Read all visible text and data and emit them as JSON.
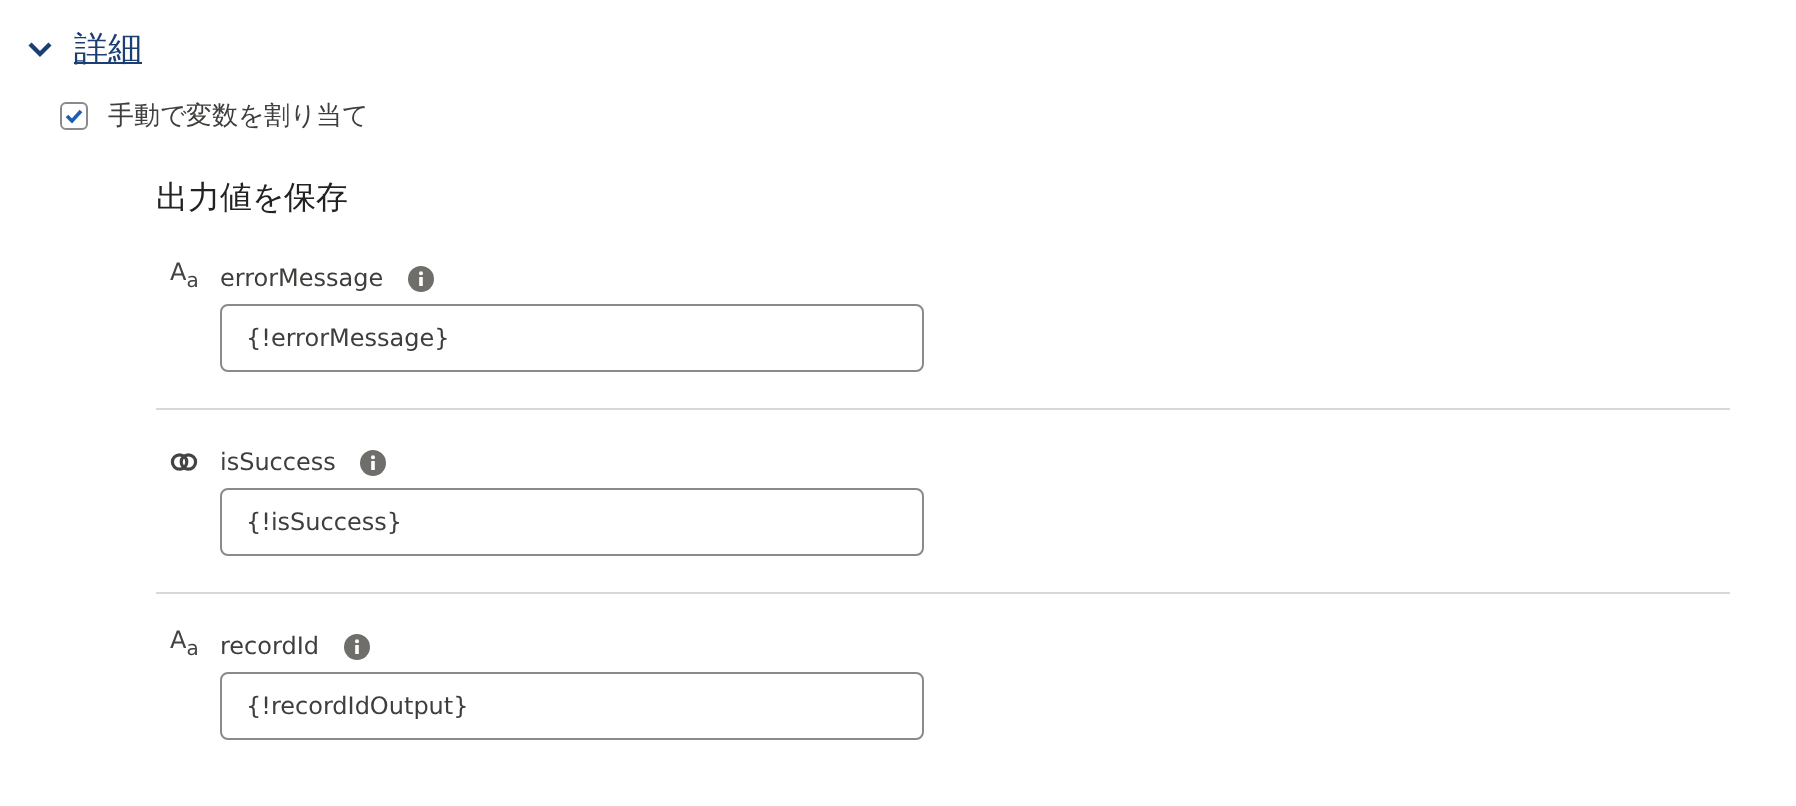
{
  "section": {
    "title": "詳細",
    "expanded": true
  },
  "manual_assign": {
    "label": "手動で変数を割り当て",
    "checked": true
  },
  "outputs": {
    "heading": "出力値を保存",
    "fields": [
      {
        "kind": "text",
        "type_icon": "A$_{a}$",
        "label": "errorMessage",
        "value": "{!errorMessage}"
      },
      {
        "kind": "boolean",
        "label": "isSuccess",
        "value": "{!isSuccess}"
      },
      {
        "kind": "text",
        "type_icon": "A$_{a}$",
        "label": "recordId",
        "value": "{!recordIdOutput}"
      }
    ]
  }
}
